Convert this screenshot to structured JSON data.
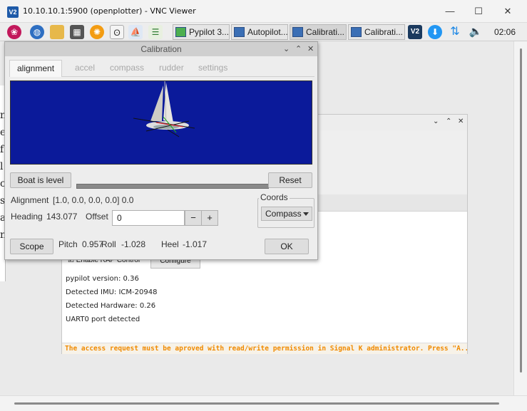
{
  "vnc": {
    "title": "10.10.10.1:5900 (openplotter) - VNC Viewer",
    "logo": "V2"
  },
  "taskbar": {
    "tasks": [
      {
        "label": "Pypilot 3..."
      },
      {
        "label": "Autopilot..."
      },
      {
        "label": "Calibrati..."
      },
      {
        "label": "Calibrati..."
      }
    ],
    "clock": "02:06"
  },
  "bgwindow": {
    "enable_label": "Enable RAP Control",
    "configure_label": "Configure",
    "info_lines": [
      "pypilot version: 0.36",
      "Detected IMU: ICM-20948",
      "Detected Hardware: 0.26",
      "UART0 port detected"
    ],
    "warning": "The access request must be aproved with read/write permission in Signal K administrator. Press \"A..."
  },
  "calibration": {
    "title": "Calibration",
    "tabs": [
      {
        "label": "alignment",
        "active": true
      },
      {
        "label": "accel"
      },
      {
        "label": "compass"
      },
      {
        "label": "rudder"
      },
      {
        "label": "settings"
      }
    ],
    "boat_level_label": "Boat is level",
    "reset_label": "Reset",
    "alignment_label": "Alignment",
    "alignment_value": "[1.0, 0.0, 0.0, 0.0] 0.0",
    "heading_label": "Heading",
    "heading_value": "143.077",
    "offset_label": "Offset",
    "offset_value": "0",
    "minus": "−",
    "plus": "+",
    "coords_label": "Coords",
    "coords_value": "Compass",
    "scope_label": "Scope",
    "pitch_label": "Pitch",
    "pitch_value": "0.957",
    "roll_label": "Roll",
    "roll_value": "-1.028",
    "heel_label": "Heel",
    "heel_value": "-1.017",
    "ok_label": "OK"
  }
}
